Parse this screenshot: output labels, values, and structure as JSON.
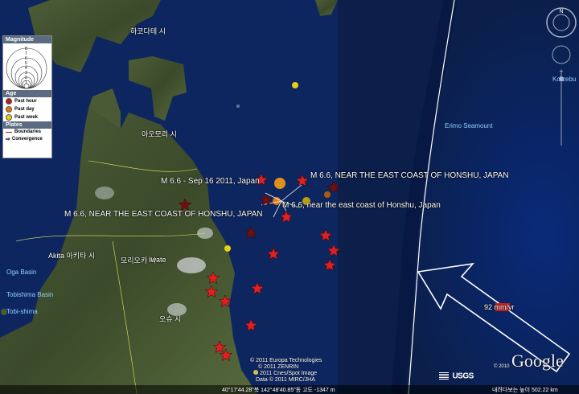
{
  "map": {
    "colors": {
      "ocean": "#0b1f4a",
      "land": "#3a4a2c",
      "past_hour": "#c01818",
      "past_day": "#e07a10",
      "past_week": "#e8d010",
      "star_old": "#6e1010",
      "star_recent": "#e02020"
    },
    "place_labels": {
      "hakodate": "하코다테 시",
      "aomori": "아오모리 시",
      "akita": "Akita 아키타 시",
      "morioka": "모리오카 시",
      "iwate": "Iwate",
      "oshu": "오슈 시",
      "oga": "Oga Basin",
      "tobishima_basin": "Tobishima Basin",
      "tobi_shima": "Tobi-shima",
      "erimo": "Erimo Seamount",
      "kotzebue": "Kotzebu"
    },
    "quake_labels": {
      "q1": "M 6.6 - Sep 16 2011, Japan",
      "q2": "M 6.6, NEAR THE EAST COAST OF HONSHU, JAPAN",
      "q3": "M 6.6, near the east coast of Honshu, Japan",
      "q4": "M 6.6, NEAR THE EAST COAST OF HONSHU, JAPAN"
    },
    "plate_rate": "92 mm/yr"
  },
  "legend": {
    "title": "Magnitude",
    "scale": [
      "8",
      "7",
      "6",
      "5",
      "4",
      "3",
      "2",
      "1"
    ],
    "age_title": "Age",
    "ages": [
      {
        "label": "Past hour",
        "color": "#c01818"
      },
      {
        "label": "Past day",
        "color": "#e07a10"
      },
      {
        "label": "Past week",
        "color": "#e8d010"
      }
    ],
    "plates_title": "Plates",
    "boundaries": "Boundaries",
    "convergence": "Convergence"
  },
  "credits": {
    "line1": "© 2011 Europa Technologies",
    "line2": "© 2011 ZENRIN",
    "line3": "© 2011 Cnes/Spot Image",
    "line4": "Data © 2011 MIRC/JHA",
    "usgs": "USGS",
    "google_year": "© 2010",
    "google": "Google"
  },
  "status": {
    "coords": "40°17'44.28\"북 142°48'40.85\"동 고도 -1347 m",
    "eye_alt": "내려다보는 높이  502.22 km"
  }
}
